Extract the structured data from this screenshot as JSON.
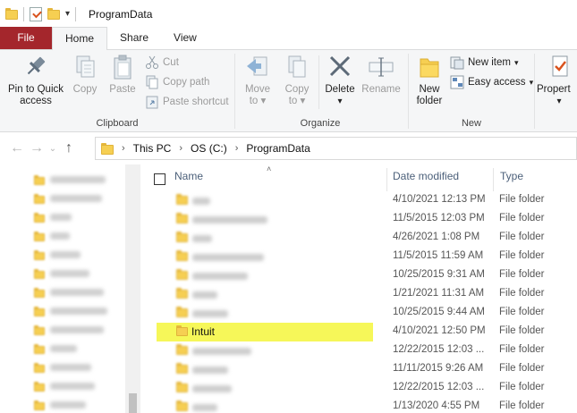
{
  "title_bar": {
    "title": "ProgramData",
    "quick_access_dropdown": "▾"
  },
  "ribbon_tabs": [
    {
      "label": "File",
      "active": false
    },
    {
      "label": "Home",
      "active": true
    },
    {
      "label": "Share",
      "active": false
    },
    {
      "label": "View",
      "active": false
    }
  ],
  "ribbon": {
    "clipboard": {
      "label": "Clipboard",
      "pin": {
        "line1": "Pin to Quick",
        "line2": "access",
        "icon": "pin-icon"
      },
      "copy": {
        "label": "Copy",
        "icon": "copy-icon"
      },
      "paste": {
        "label": "Paste",
        "icon": "paste-icon"
      },
      "cut": {
        "label": "Cut",
        "icon": "scissors-icon"
      },
      "copy_path": {
        "label": "Copy path",
        "icon": "copy-path-icon"
      },
      "paste_shortcut": {
        "label": "Paste shortcut",
        "icon": "paste-shortcut-icon"
      }
    },
    "organize": {
      "label": "Organize",
      "move_to": {
        "line1": "Move",
        "line2": "to",
        "icon": "move-to-icon"
      },
      "copy_to": {
        "line1": "Copy",
        "line2": "to",
        "icon": "copy-to-icon"
      },
      "delete": {
        "label": "Delete",
        "icon": "delete-x-icon"
      },
      "rename": {
        "label": "Rename",
        "icon": "rename-icon"
      }
    },
    "new": {
      "label": "New",
      "new_folder": {
        "line1": "New",
        "line2": "folder",
        "icon": "new-folder-icon"
      },
      "new_item": {
        "label": "New item",
        "icon": "new-item-icon"
      },
      "easy_access": {
        "label": "Easy access",
        "icon": "easy-access-icon"
      }
    },
    "open": {
      "properties": {
        "label": "Propert",
        "icon": "properties-icon"
      }
    }
  },
  "address_bar": {
    "breadcrumbs": [
      "This PC",
      "OS (C:)",
      "ProgramData"
    ],
    "separator": "›"
  },
  "columns": {
    "name": "Name",
    "date_modified": "Date modified",
    "type": "Type"
  },
  "files": [
    {
      "name": "",
      "date": "4/10/2021 12:13 PM",
      "type": "File folder",
      "blurred": true
    },
    {
      "name": "",
      "date": "11/5/2015 12:03 PM",
      "type": "File folder",
      "blurred": true
    },
    {
      "name": "",
      "date": "4/26/2021 1:08 PM",
      "type": "File folder",
      "blurred": true
    },
    {
      "name": "",
      "date": "11/5/2015 11:59 AM",
      "type": "File folder",
      "blurred": true
    },
    {
      "name": "",
      "date": "10/25/2015 9:31 AM",
      "type": "File folder",
      "blurred": true
    },
    {
      "name": "",
      "date": "1/21/2021 11:31 AM",
      "type": "File folder",
      "blurred": true
    },
    {
      "name": "",
      "date": "10/25/2015 9:44 AM",
      "type": "File folder",
      "blurred": true
    },
    {
      "name": "Intuit",
      "date": "4/10/2021 12:50 PM",
      "type": "File folder",
      "blurred": false,
      "highlighted": true
    },
    {
      "name": "",
      "date": "12/22/2015 12:03 ...",
      "type": "File folder",
      "blurred": true
    },
    {
      "name": "",
      "date": "11/11/2015 9:26 AM",
      "type": "File folder",
      "blurred": true
    },
    {
      "name": "",
      "date": "12/22/2015 12:03 ...",
      "type": "File folder",
      "blurred": true
    },
    {
      "name": "",
      "date": "1/13/2020 4:55 PM",
      "type": "File folder",
      "blurred": true
    }
  ],
  "colors": {
    "file_tab": "#a4262c",
    "highlight": "#f6f759",
    "folder": "#f6cf52"
  }
}
